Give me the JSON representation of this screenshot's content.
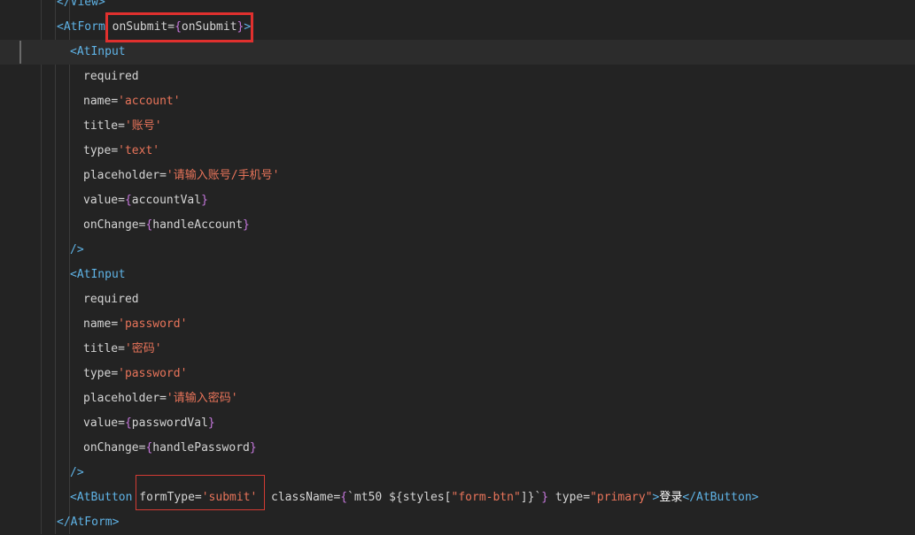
{
  "code_lines": [
    {
      "indent": 64,
      "tokens": [
        {
          "t": "</View>",
          "c": "tag"
        }
      ]
    },
    {
      "indent": 64,
      "tokens": [
        {
          "t": "<AtForm",
          "c": "tag"
        },
        {
          "t": " onSubmit",
          "c": "attr"
        },
        {
          "t": "=",
          "c": "eq"
        },
        {
          "t": "{",
          "c": "brace"
        },
        {
          "t": "onSubmit",
          "c": "expr"
        },
        {
          "t": "}",
          "c": "brace"
        },
        {
          "t": ">",
          "c": "punc"
        }
      ]
    },
    {
      "indent": 79,
      "current": true,
      "tokens": [
        {
          "t": "<AtInput",
          "c": "tag"
        }
      ]
    },
    {
      "indent": 94,
      "tokens": [
        {
          "t": "required",
          "c": "attr"
        }
      ]
    },
    {
      "indent": 94,
      "tokens": [
        {
          "t": "name",
          "c": "attr"
        },
        {
          "t": "=",
          "c": "eq"
        },
        {
          "t": "'account'",
          "c": "str"
        }
      ]
    },
    {
      "indent": 94,
      "tokens": [
        {
          "t": "title",
          "c": "attr"
        },
        {
          "t": "=",
          "c": "eq"
        },
        {
          "t": "'账号'",
          "c": "str"
        }
      ]
    },
    {
      "indent": 94,
      "tokens": [
        {
          "t": "type",
          "c": "attr"
        },
        {
          "t": "=",
          "c": "eq"
        },
        {
          "t": "'text'",
          "c": "str"
        }
      ]
    },
    {
      "indent": 94,
      "tokens": [
        {
          "t": "placeholder",
          "c": "attr"
        },
        {
          "t": "=",
          "c": "eq"
        },
        {
          "t": "'请输入账号/手机号'",
          "c": "str"
        }
      ]
    },
    {
      "indent": 94,
      "tokens": [
        {
          "t": "value",
          "c": "attr"
        },
        {
          "t": "=",
          "c": "eq"
        },
        {
          "t": "{",
          "c": "brace"
        },
        {
          "t": "accountVal",
          "c": "expr"
        },
        {
          "t": "}",
          "c": "brace"
        }
      ]
    },
    {
      "indent": 94,
      "tokens": [
        {
          "t": "onChange",
          "c": "attr"
        },
        {
          "t": "=",
          "c": "eq"
        },
        {
          "t": "{",
          "c": "brace"
        },
        {
          "t": "handleAccount",
          "c": "expr"
        },
        {
          "t": "}",
          "c": "brace"
        }
      ]
    },
    {
      "indent": 79,
      "tokens": [
        {
          "t": "/>",
          "c": "tag"
        }
      ]
    },
    {
      "indent": 79,
      "tokens": [
        {
          "t": "<AtInput",
          "c": "tag"
        }
      ]
    },
    {
      "indent": 94,
      "tokens": [
        {
          "t": "required",
          "c": "attr"
        }
      ]
    },
    {
      "indent": 94,
      "tokens": [
        {
          "t": "name",
          "c": "attr"
        },
        {
          "t": "=",
          "c": "eq"
        },
        {
          "t": "'password'",
          "c": "str"
        }
      ]
    },
    {
      "indent": 94,
      "tokens": [
        {
          "t": "title",
          "c": "attr"
        },
        {
          "t": "=",
          "c": "eq"
        },
        {
          "t": "'密码'",
          "c": "str"
        }
      ]
    },
    {
      "indent": 94,
      "tokens": [
        {
          "t": "type",
          "c": "attr"
        },
        {
          "t": "=",
          "c": "eq"
        },
        {
          "t": "'password'",
          "c": "str"
        }
      ]
    },
    {
      "indent": 94,
      "tokens": [
        {
          "t": "placeholder",
          "c": "attr"
        },
        {
          "t": "=",
          "c": "eq"
        },
        {
          "t": "'请输入密码'",
          "c": "str"
        }
      ]
    },
    {
      "indent": 94,
      "tokens": [
        {
          "t": "value",
          "c": "attr"
        },
        {
          "t": "=",
          "c": "eq"
        },
        {
          "t": "{",
          "c": "brace"
        },
        {
          "t": "passwordVal",
          "c": "expr"
        },
        {
          "t": "}",
          "c": "brace"
        }
      ]
    },
    {
      "indent": 94,
      "tokens": [
        {
          "t": "onChange",
          "c": "attr"
        },
        {
          "t": "=",
          "c": "eq"
        },
        {
          "t": "{",
          "c": "brace"
        },
        {
          "t": "handlePassword",
          "c": "expr"
        },
        {
          "t": "}",
          "c": "brace"
        }
      ]
    },
    {
      "indent": 79,
      "tokens": [
        {
          "t": "/>",
          "c": "tag"
        }
      ]
    },
    {
      "indent": 79,
      "tokens": [
        {
          "t": "<AtButton",
          "c": "tag"
        },
        {
          "t": " formType",
          "c": "attr"
        },
        {
          "t": "=",
          "c": "eq"
        },
        {
          "t": "'submit'",
          "c": "str"
        },
        {
          "t": "  className",
          "c": "attr"
        },
        {
          "t": "=",
          "c": "eq"
        },
        {
          "t": "{",
          "c": "brace"
        },
        {
          "t": "`mt50 ${styles[",
          "c": "tpl"
        },
        {
          "t": "\"form-btn\"",
          "c": "str"
        },
        {
          "t": "]}`",
          "c": "tpl"
        },
        {
          "t": "}",
          "c": "brace"
        },
        {
          "t": " type",
          "c": "attr"
        },
        {
          "t": "=",
          "c": "eq"
        },
        {
          "t": "\"primary\"",
          "c": "str"
        },
        {
          "t": ">",
          "c": "tag"
        },
        {
          "t": "登录",
          "c": "text"
        },
        {
          "t": "</AtButton>",
          "c": "tag"
        }
      ]
    },
    {
      "indent": 64,
      "tokens": [
        {
          "t": "</AtForm>",
          "c": "tag"
        }
      ]
    }
  ]
}
